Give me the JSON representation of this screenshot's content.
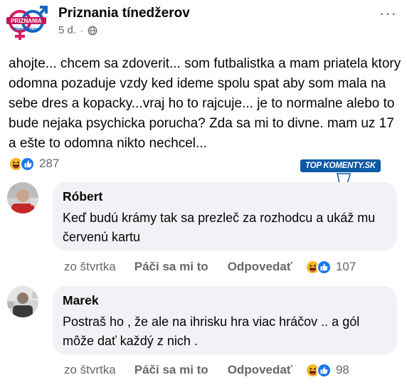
{
  "post": {
    "page_name": "Priznania tínedžerov",
    "logo_text_top": "PRIZNANIA",
    "logo_text_bottom": "tínedžerov",
    "time": "5 d.",
    "dot": "·",
    "more": "···",
    "text": "ahojte... chcem sa zdoverit... som futbalistka a mam priatela ktory odomna pozaduje vzdy ked ideme spolu spat aby som mala na sebe dres a kopacky...vraj ho to rajcuje... je to normalne alebo to bude nejaka psychicka porucha? Zda sa mi to divne. mam uz 17 a ešte to odomna nikto nechcel...",
    "reaction_count": "287"
  },
  "badge": {
    "label": "TOP KOMENTY.SK"
  },
  "comments": [
    {
      "author": "Róbert",
      "text": "Keď budú krámy tak sa prezleč za rozhodcu a ukáž mu červenú kartu",
      "time": "zo štvrtka",
      "like": "Páči sa mi to",
      "reply": "Odpovedať",
      "reaction_count": "107"
    },
    {
      "author": "Marek",
      "text": "Postraš ho , že ale na ihrisku hra viac hráčov .. a gól môže dať každý z nich .",
      "time": "zo štvrtka",
      "like": "Páči sa mi to",
      "reply": "Odpovedať",
      "reaction_count": "98"
    }
  ],
  "colors": {
    "like_blue": "#1877f2",
    "haha_yellow": "#f7b928",
    "secondary_text": "#65676b",
    "bubble_bg": "#f0f2f5",
    "badge_blue": "#0b5aa6"
  }
}
